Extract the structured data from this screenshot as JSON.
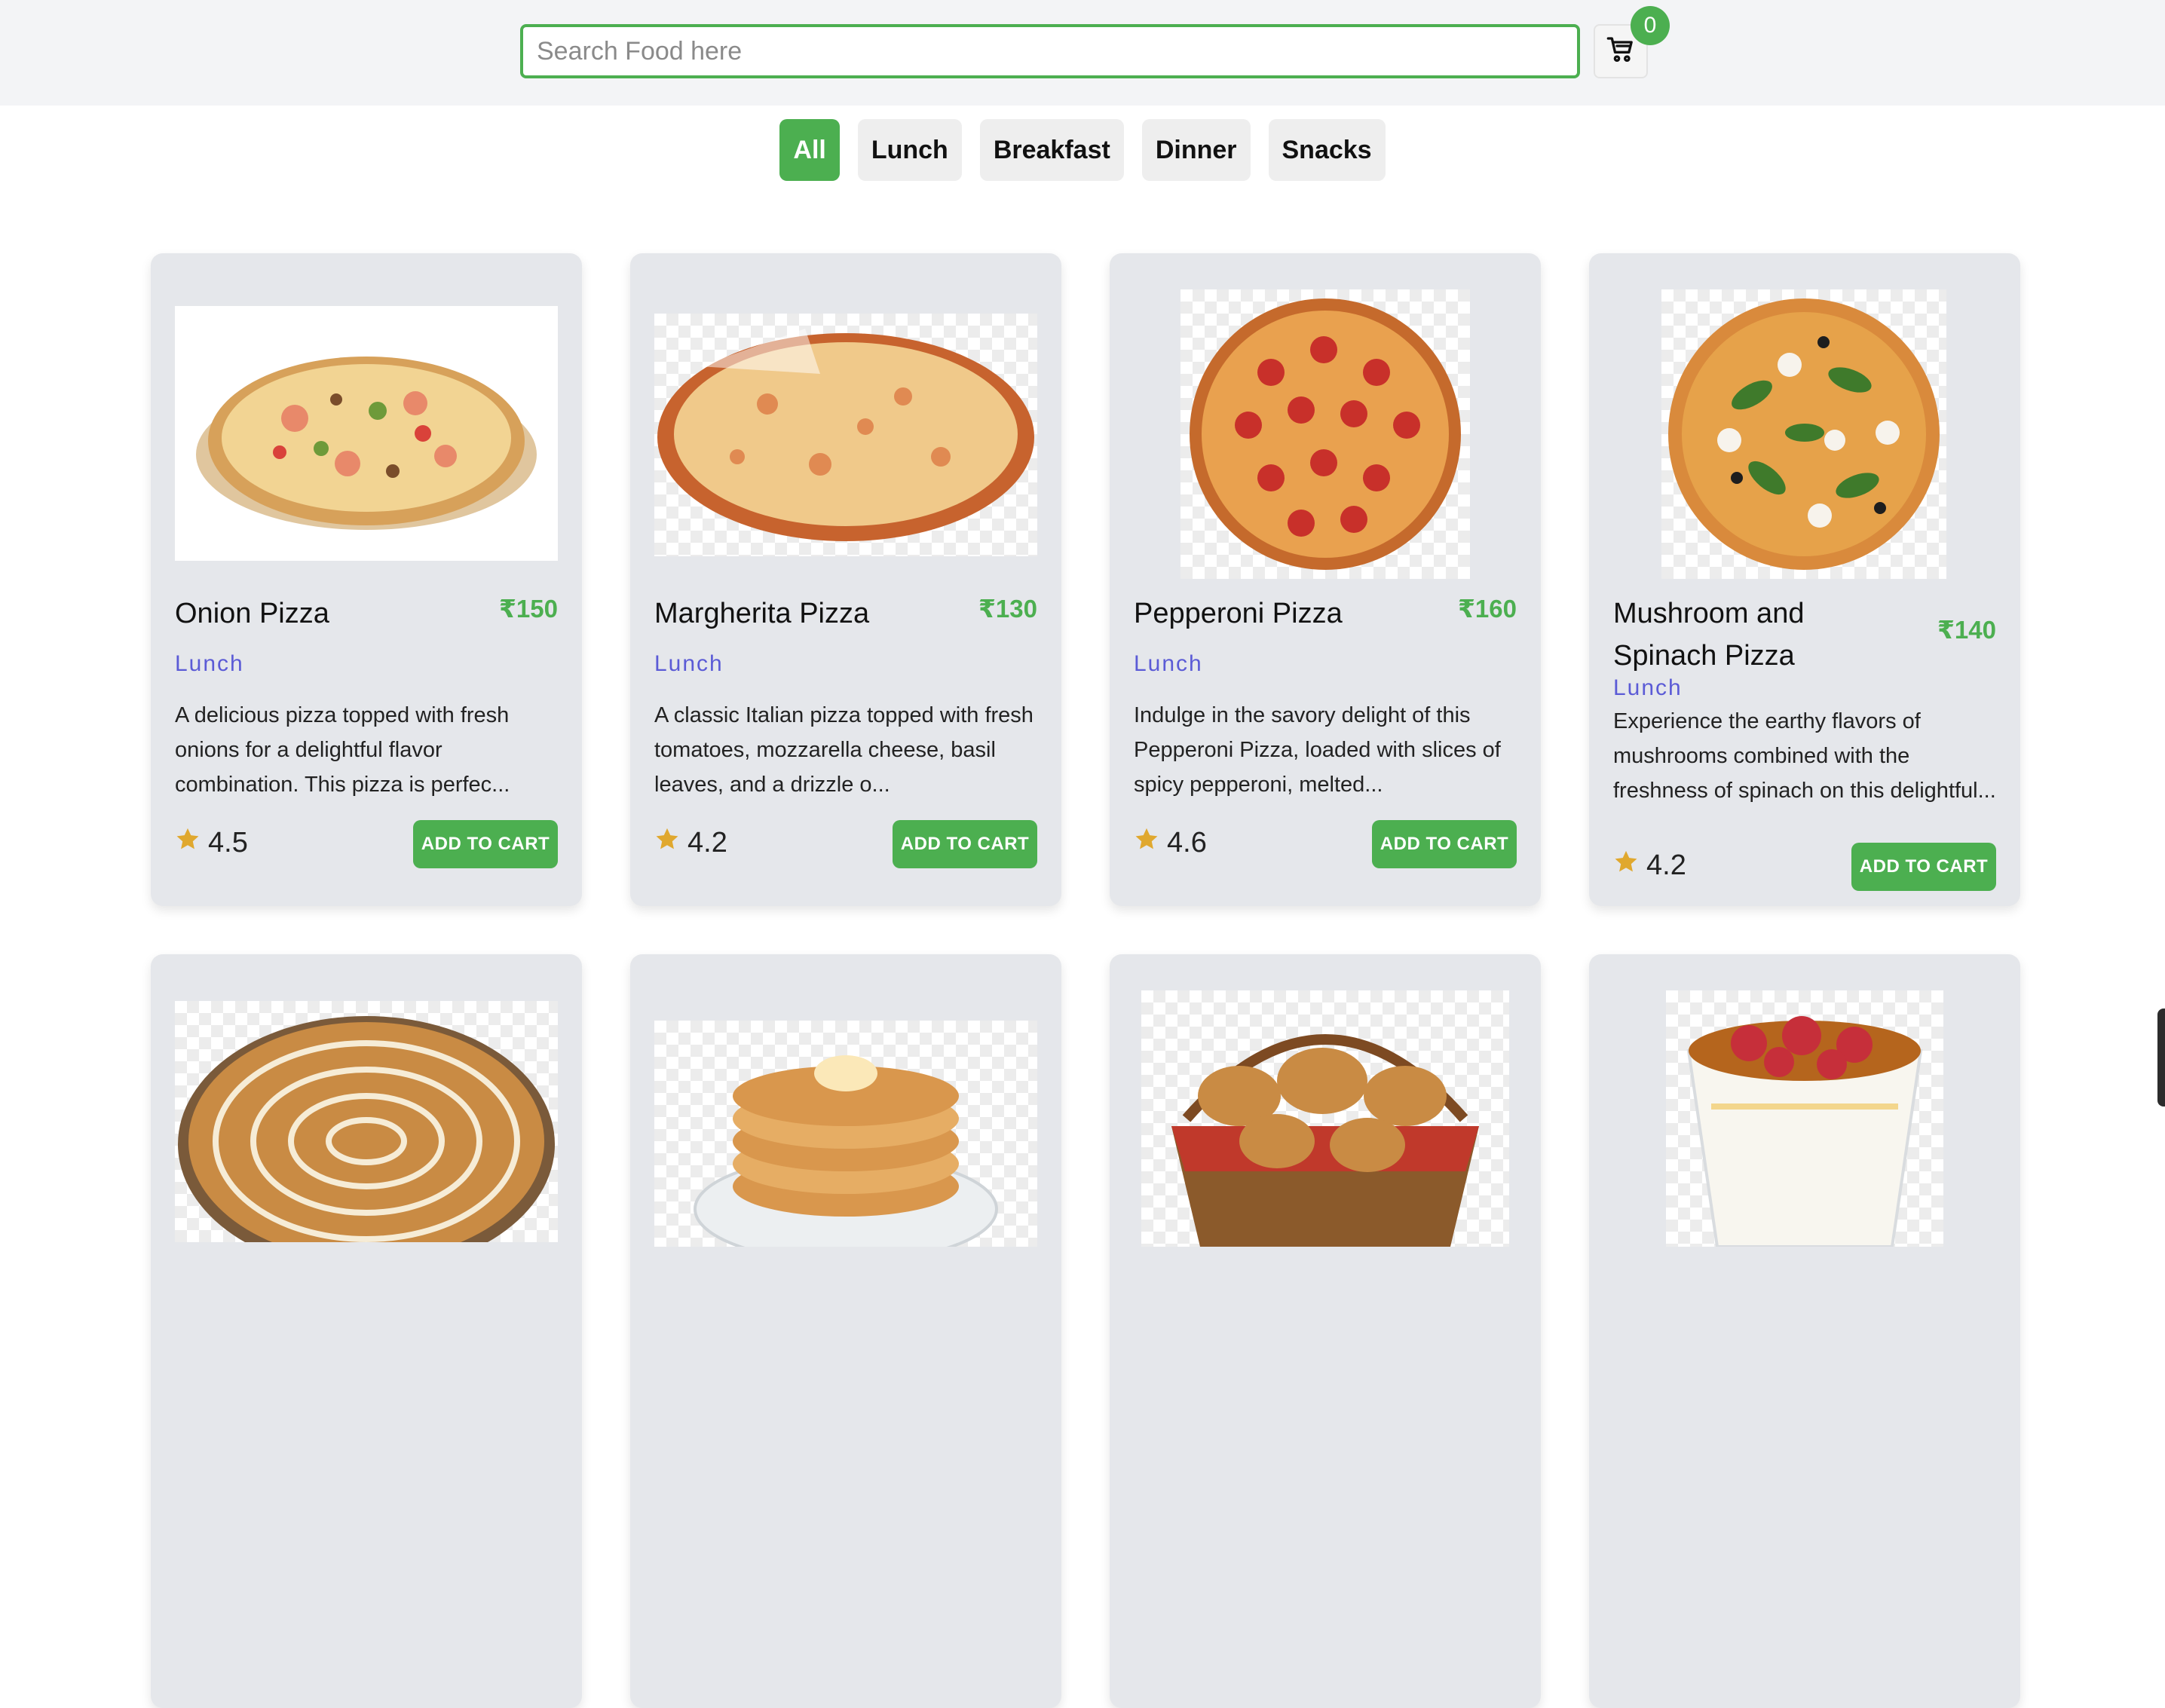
{
  "header": {
    "search_placeholder": "Search Food here",
    "search_value": "",
    "cart_count": "0",
    "accent_color": "#4caf50"
  },
  "filters": [
    {
      "label": "All",
      "active": true
    },
    {
      "label": "Lunch",
      "active": false
    },
    {
      "label": "Breakfast",
      "active": false
    },
    {
      "label": "Dinner",
      "active": false
    },
    {
      "label": "Snacks",
      "active": false
    }
  ],
  "products": [
    {
      "name": "Onion Pizza",
      "price": "₹150",
      "category": "Lunch",
      "description": "A delicious pizza topped with fresh onions for a delightful flavor combination. This pizza is perfec...",
      "rating": "4.5",
      "button": "ADD TO CART",
      "image_icon": "onion-pizza-image"
    },
    {
      "name": "Margherita Pizza",
      "price": "₹130",
      "category": "Lunch",
      "description": "A classic Italian pizza topped with fresh tomatoes, mozzarella cheese, basil leaves, and a drizzle o...",
      "rating": "4.2",
      "button": "ADD TO CART",
      "image_icon": "margherita-pizza-image"
    },
    {
      "name": "Pepperoni Pizza",
      "price": "₹160",
      "category": "Lunch",
      "description": "Indulge in the savory delight of this Pepperoni Pizza, loaded with slices of spicy pepperoni, melted...",
      "rating": "4.6",
      "button": "ADD TO CART",
      "image_icon": "pepperoni-pizza-image"
    },
    {
      "name": "Mushroom and Spinach Pizza",
      "price": "₹140",
      "category": "Lunch",
      "description": "Experience the earthy flavors of mushrooms combined with the freshness of spinach on this delightful...",
      "rating": "4.2",
      "button": "ADD TO CART",
      "image_icon": "mushroom-spinach-pizza-image"
    }
  ],
  "partial_products": [
    {
      "image_icon": "chicken-pizza-image"
    },
    {
      "image_icon": "pancakes-image"
    },
    {
      "image_icon": "pastry-basket-image"
    },
    {
      "image_icon": "yogurt-parfait-image"
    }
  ]
}
